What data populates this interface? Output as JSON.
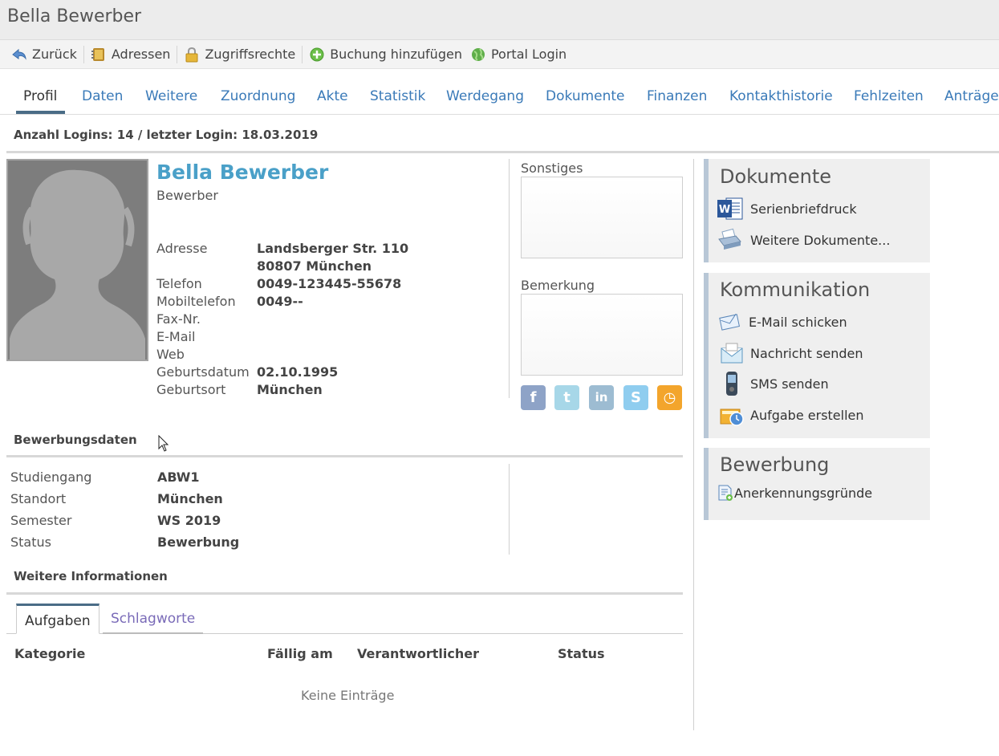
{
  "window": {
    "title": "Bella Bewerber"
  },
  "toolbar": {
    "back": "Zurück",
    "addresses": "Adressen",
    "access_rights": "Zugriffsrechte",
    "add_booking": "Buchung hinzufügen",
    "portal_login": "Portal Login"
  },
  "tabs": [
    "Profil",
    "Daten",
    "Weitere",
    "Zuordnung",
    "Akte",
    "Statistik",
    "Werdegang",
    "Dokumente",
    "Finanzen",
    "Kontakthistorie",
    "Fehlzeiten",
    "Anträge"
  ],
  "login_info": "Anzahl Logins: 14 / letzter Login: 18.03.2019",
  "profile": {
    "name": "Bella Bewerber",
    "role": "Bewerber",
    "fields": [
      {
        "label": "Adresse",
        "value": "Landsberger Str. 110"
      },
      {
        "label": "",
        "value": "80807 München"
      },
      {
        "label": "Telefon",
        "value": "0049-123445-55678"
      },
      {
        "label": "Mobiltelefon",
        "value": "0049--"
      },
      {
        "label": "Fax-Nr.",
        "value": ""
      },
      {
        "label": "E-Mail",
        "value": ""
      },
      {
        "label": "Web",
        "value": ""
      },
      {
        "label": "Geburtsdatum",
        "value": "02.10.1995"
      },
      {
        "label": "Geburtsort",
        "value": "München"
      }
    ],
    "other_label": "Sonstiges",
    "other_value": "",
    "remark_label": "Bemerkung",
    "remark_value": ""
  },
  "social": [
    {
      "icon": "facebook-icon",
      "glyph": "f",
      "color": "#8ea3c7"
    },
    {
      "icon": "twitter-icon",
      "glyph": "t",
      "color": "#a7d7e8"
    },
    {
      "icon": "linkedin-icon",
      "glyph": "in",
      "color": "#9dbcd2"
    },
    {
      "icon": "skype-icon",
      "glyph": "S",
      "color": "#8fcdef"
    },
    {
      "icon": "clock-icon",
      "glyph": "◷",
      "color": "#f3a52c"
    }
  ],
  "application": {
    "title": "Bewerbungsdaten",
    "rows": [
      {
        "label": "Studiengang",
        "value": "ABW1"
      },
      {
        "label": "Standort",
        "value": "München"
      },
      {
        "label": "Semester",
        "value": "WS 2019"
      },
      {
        "label": "Status",
        "value": "Bewerbung"
      }
    ]
  },
  "more_info": {
    "title": "Weitere Informationen",
    "tabs": [
      "Aufgaben",
      "Schlagworte"
    ],
    "columns": [
      "Kategorie",
      "Fällig am",
      "Verantwortlicher",
      "Status"
    ],
    "empty_text": "Keine Einträge"
  },
  "sidebar": {
    "documents": {
      "title": "Dokumente",
      "items": [
        "Serienbriefdruck",
        "Weitere Dokumente..."
      ]
    },
    "communication": {
      "title": "Kommunikation",
      "items": [
        "E-Mail schicken",
        "Nachricht senden",
        "SMS senden",
        "Aufgabe erstellen"
      ]
    },
    "application": {
      "title": "Bewerbung",
      "items": [
        "Anerkennungsgründe"
      ]
    }
  }
}
